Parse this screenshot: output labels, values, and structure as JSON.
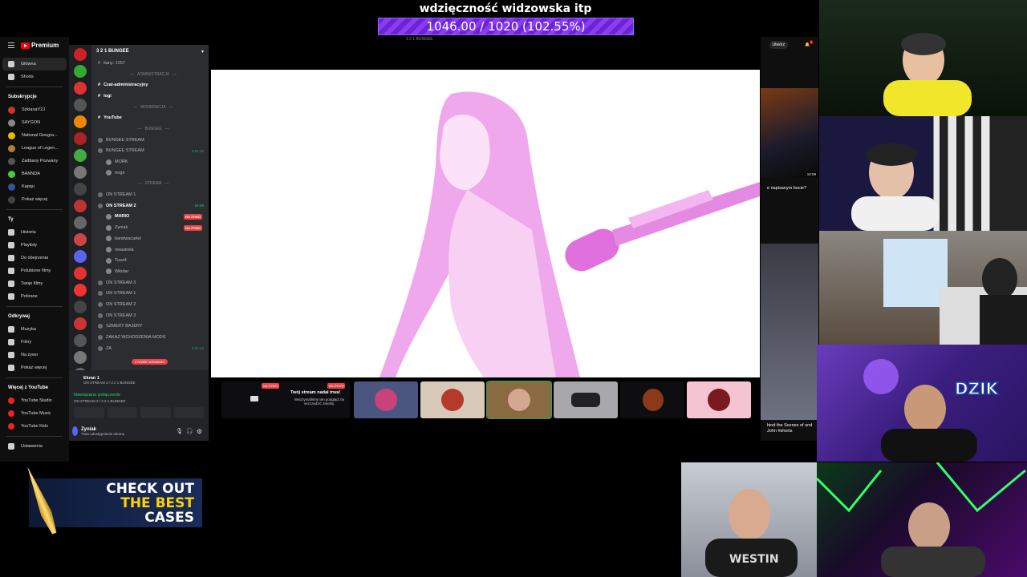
{
  "goal": {
    "title": "wdzięczność widzowska itp",
    "progress_text": "1046.00 / 1020 (102.55%)",
    "progress_percent": 102.55
  },
  "youtube": {
    "logo": "Premium",
    "nav": [
      {
        "label": "Główna",
        "icon": "home-icon"
      },
      {
        "label": "Shorts",
        "icon": "shorts-icon"
      }
    ],
    "subs_header": "Subskrypcje",
    "subs": [
      {
        "label": "SzklanaY2J",
        "color": "#c33"
      },
      {
        "label": "SAYGON",
        "color": "#888"
      },
      {
        "label": "National Geogra...",
        "color": "#e6b800"
      },
      {
        "label": "League of Legen...",
        "color": "#b08030"
      },
      {
        "label": "Zadbany Pozwany",
        "color": "#555"
      },
      {
        "label": "BANNDA",
        "color": "#4c4"
      },
      {
        "label": "Kapqu",
        "color": "#359"
      },
      {
        "label": "Pokaż więcej",
        "color": "#444"
      }
    ],
    "you_header": "Ty",
    "you": [
      "Historia",
      "Playlisty",
      "Do obejrzenia",
      "Polubione filmy",
      "Twoje filmy",
      "Pobrane"
    ],
    "explore_header": "Odkrywaj",
    "explore": [
      "Muzyka",
      "Filmy",
      "Na żywo",
      "Pokaż więcej"
    ],
    "more_header": "Więcej z YouTube",
    "more": [
      "YouTube Studio",
      "YouTube Music",
      "YouTube Kids"
    ],
    "settings": "Ustawienia",
    "top_right": {
      "create": "Utwórz",
      "notif_count": "9"
    },
    "side_text_1": "e napisanym bocie?",
    "side_text_2": "hind the Scenes of ond John #shorts",
    "side_time": "10:09"
  },
  "discord": {
    "server_name": "3 2 1 BUNGEE",
    "channels": [
      {
        "type": "text",
        "label": "itany: 1057"
      },
      {
        "type": "cat",
        "label": "ADMINISTRACJA"
      },
      {
        "type": "text",
        "label": "Czat-administracyjny",
        "bold": true
      },
      {
        "type": "text",
        "label": "logi",
        "bold": true
      },
      {
        "type": "cat",
        "label": "MODERACJA"
      },
      {
        "type": "text",
        "label": "YouTube",
        "bold": true
      },
      {
        "type": "cat",
        "label": "BUNGEE"
      },
      {
        "type": "voice",
        "label": "BUNGEE STREAM"
      },
      {
        "type": "voice",
        "label": "BUNGEE STREAM",
        "time": "2:51:30"
      },
      {
        "type": "user",
        "label": "MORK"
      },
      {
        "type": "user",
        "label": "mrgn"
      },
      {
        "type": "cat",
        "label": "STREAM"
      },
      {
        "type": "voice",
        "label": "ON STREAM 1"
      },
      {
        "type": "voice",
        "label": "ON STREAM 2",
        "bold": true,
        "time": "10:09"
      },
      {
        "type": "user",
        "label": "MARIO",
        "live": "NA ŻYWO",
        "bold": true
      },
      {
        "type": "user",
        "label": "Zyniak",
        "live": "NA ŻYWO"
      },
      {
        "type": "user",
        "label": "bandwacartel"
      },
      {
        "type": "user",
        "label": "nwastrela"
      },
      {
        "type": "user",
        "label": "Tusz4"
      },
      {
        "type": "user",
        "label": "Włodar"
      },
      {
        "type": "voice",
        "label": "ON STREAM 3"
      },
      {
        "type": "voice",
        "label": "ON STREAM 1"
      },
      {
        "type": "voice",
        "label": "ON STREAM 2"
      },
      {
        "type": "voice",
        "label": "ON STREAM 3"
      },
      {
        "type": "voice",
        "label": "SZMERY BAJERY"
      },
      {
        "type": "voice",
        "label": "ZAKAZ WCHODZENIA MODS"
      },
      {
        "type": "voice",
        "label": "ZA",
        "time": "5:34:43"
      }
    ],
    "new_messages": "2 NOWE WZMIANKI",
    "stream": {
      "title": "Ekran 1",
      "sub": "ON STREAM 2 / 3 2 1 BUNGEE"
    },
    "voice_connected": "Nawiązano połączenie",
    "voice_sub": "ON STREAM 2 / 3 2 1 BUNGEE",
    "user": {
      "name": "Zyniak",
      "status": "Trwa udostępnianie ekranu"
    }
  },
  "stage": {
    "title": "3 2 1 BUNGEE",
    "live_badge": "NA ŻYWO",
    "notice_title": "Twój stream nadal trwa!",
    "notice_body": "Wstrzymaliśmy ten podgląd, by oszczędzić zasoby."
  },
  "ad": {
    "line1": "CHECK OUT",
    "line2": "THE BEST",
    "line3": "CASES"
  },
  "colors": {
    "accent": "#7b34e8",
    "discord_bg": "#2b2d31",
    "live": "#ed4245",
    "pink": "#f08ee8"
  }
}
